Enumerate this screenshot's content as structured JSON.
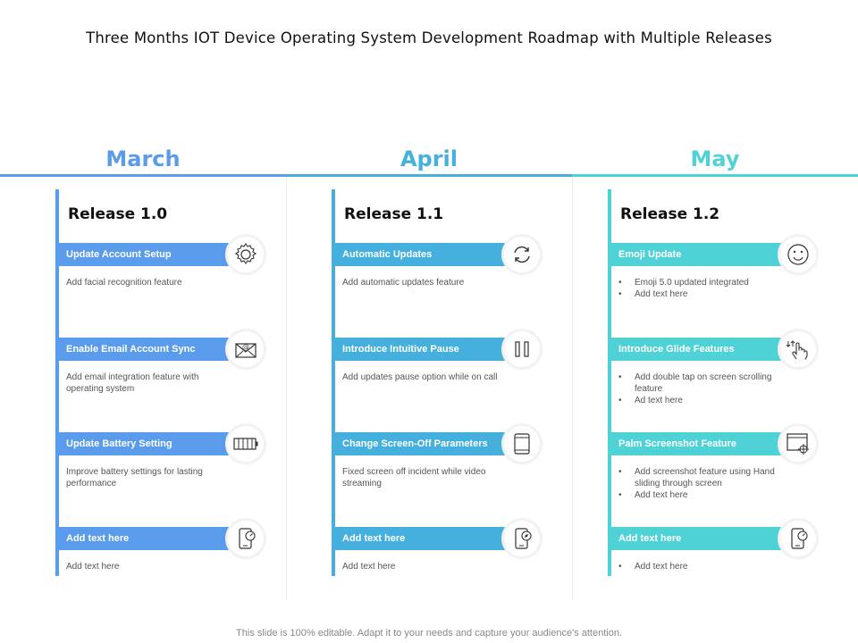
{
  "title": "Three Months IOT Device Operating System Development Roadmap with Multiple Releases",
  "footer": "This slide is 100% editable. Adapt it to your needs and capture your audience's attention.",
  "colors": {
    "march": "#5b9bec",
    "april": "#45b0dd",
    "may": "#4fd2d6"
  },
  "columns": [
    {
      "month": "March",
      "release": "Release 1.0",
      "items": [
        {
          "label": "Update Account Setup",
          "icon": "gear-icon",
          "desc": "Add facial recognition feature",
          "bullets": []
        },
        {
          "label": "Enable Email Account Sync",
          "icon": "email-icon",
          "desc": "Add email integration feature with operating system",
          "bullets": []
        },
        {
          "label": "Update Battery Setting",
          "icon": "battery-icon",
          "desc": "Improve battery settings for lasting performance",
          "bullets": []
        },
        {
          "label": "Add text here",
          "icon": "phone-speed-icon",
          "desc": "Add text here",
          "bullets": []
        }
      ]
    },
    {
      "month": "April",
      "release": "Release 1.1",
      "items": [
        {
          "label": "Automatic Updates",
          "icon": "refresh-icon",
          "desc": "Add automatic updates feature",
          "bullets": []
        },
        {
          "label": "Introduce Intuitive Pause",
          "icon": "pause-icon",
          "desc": "Add updates pause option while on call",
          "bullets": []
        },
        {
          "label": "Change Screen-Off Parameters",
          "icon": "tablet-icon",
          "desc": "Fixed screen off incident while video streaming",
          "bullets": []
        },
        {
          "label": "Add text here",
          "icon": "phone-compass-icon",
          "desc": "Add text here",
          "bullets": []
        }
      ]
    },
    {
      "month": "May",
      "release": "Release 1.2",
      "items": [
        {
          "label": "Emoji Update",
          "icon": "smiley-icon",
          "desc": "",
          "bullets": [
            "Emoji 5.0 updated integrated",
            "Add text here"
          ]
        },
        {
          "label": "Introduce Glide Features",
          "icon": "hand-swipe-icon",
          "desc": "",
          "bullets": [
            "Add double tap on screen scrolling feature",
            "Ad text here"
          ]
        },
        {
          "label": "Palm Screenshot Feature",
          "icon": "screenshot-icon",
          "desc": "",
          "bullets": [
            "Add screenshot feature using Hand sliding through screen",
            "Add text here"
          ]
        },
        {
          "label": "Add text here",
          "icon": "phone-speed-icon",
          "desc": "",
          "bullets": [
            "Add text here"
          ]
        }
      ]
    }
  ]
}
